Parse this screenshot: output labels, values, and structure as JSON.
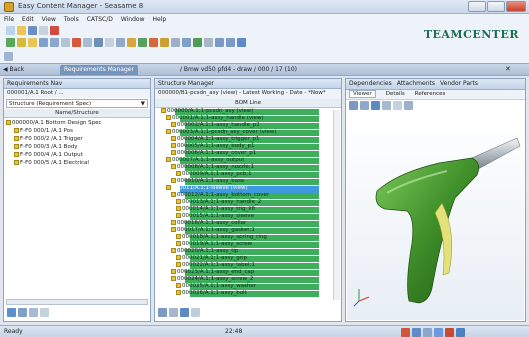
{
  "window": {
    "title": "Easy Content Manager - Seasame 8"
  },
  "menu": [
    "File",
    "Edit",
    "View",
    "Tools",
    "CATSC/D",
    "Window",
    "Help"
  ],
  "brand": "TEAMCENTER",
  "navbar": {
    "back_label": "Back",
    "tab_label": "Requirements Manager",
    "path": "/ Bmw vd50 pfd4 - draw / 000 / 17 (10)"
  },
  "left_panel": {
    "title": "Requirements Nav",
    "subtitle": "000001/A.1 Root / ...",
    "dropdown_label": "Structure (Requirement Spec)",
    "column": "Name/Structure",
    "items": [
      "000000/A.1 Bottom Design Spec",
      "F-F0 000/1 /A.1 Pos",
      "F-F0 000/2 /A.1 Trigger",
      "F-F0 000/3 /A.1 Body",
      "F-F0 000/4 /A.1 Output",
      "F-F0 000/5 /A.1 Electrical"
    ]
  },
  "center_panel": {
    "title": "Structure Manager",
    "breadcrumb": "000000/B1-pcsdn_asy (view) - Latest Working - Date - *Now*",
    "column": "BOM Line",
    "rows": [
      "000000/A.1;1-pcsdn_asy (view)",
      "000001/A.1;1-assy_handle (view)",
      "000002/A.1;1-assy_handle_p2",
      "000003/A.1;1-pcsdn_asy_cover (view)",
      "000004/A.1;1-assy_trigger_p1",
      "000005/A.1;1-assy_body_p1",
      "000006/A.1;1-assy_cover_p1",
      "000007/A.1;1-assy_output",
      "000008/A.1;1-assy_nozzle;1",
      "000009/A.1;1-assy_pcb;1",
      "000010/A.1;1-assy_base",
      "000011/A.1;1-sleeve (view)",
      "000012/A.1;1-assy_bottom_cover",
      "000013/A.1;1-assy_handle_2",
      "000014/A.1;1-assy_trig_lift",
      "000015/A.1;1-assy_sleeve",
      "000016/A.1;1-assy_collar",
      "000017/A.1;1-assy_gasket;1",
      "000018/A.1;1-assy_spring_ring",
      "000019/A.1;1-assy_screw",
      "000020/A.1;1-assy_tip",
      "000021/A.1;1-assy_grip",
      "000022/A.1;1-assy_label;1",
      "000023/A.1;1-assy_end_cap",
      "000024/A.1;1-assy_screw_2",
      "000025/A.1;1-assy_washer",
      "000026/A.1;1-assy_bolt"
    ],
    "selected_index": 11
  },
  "right_panel": {
    "tabs": [
      "Dependencies",
      "Attachments",
      "Vendor Parts"
    ],
    "subtabs": [
      "Viewer",
      "Details",
      "References"
    ]
  },
  "status": {
    "left": "Ready",
    "center": "22:48"
  },
  "colors": {
    "accent": "#3cae5c",
    "selection": "#3d9ae0",
    "brand": "#1c6d52",
    "model_green": "#3f8f2a"
  }
}
